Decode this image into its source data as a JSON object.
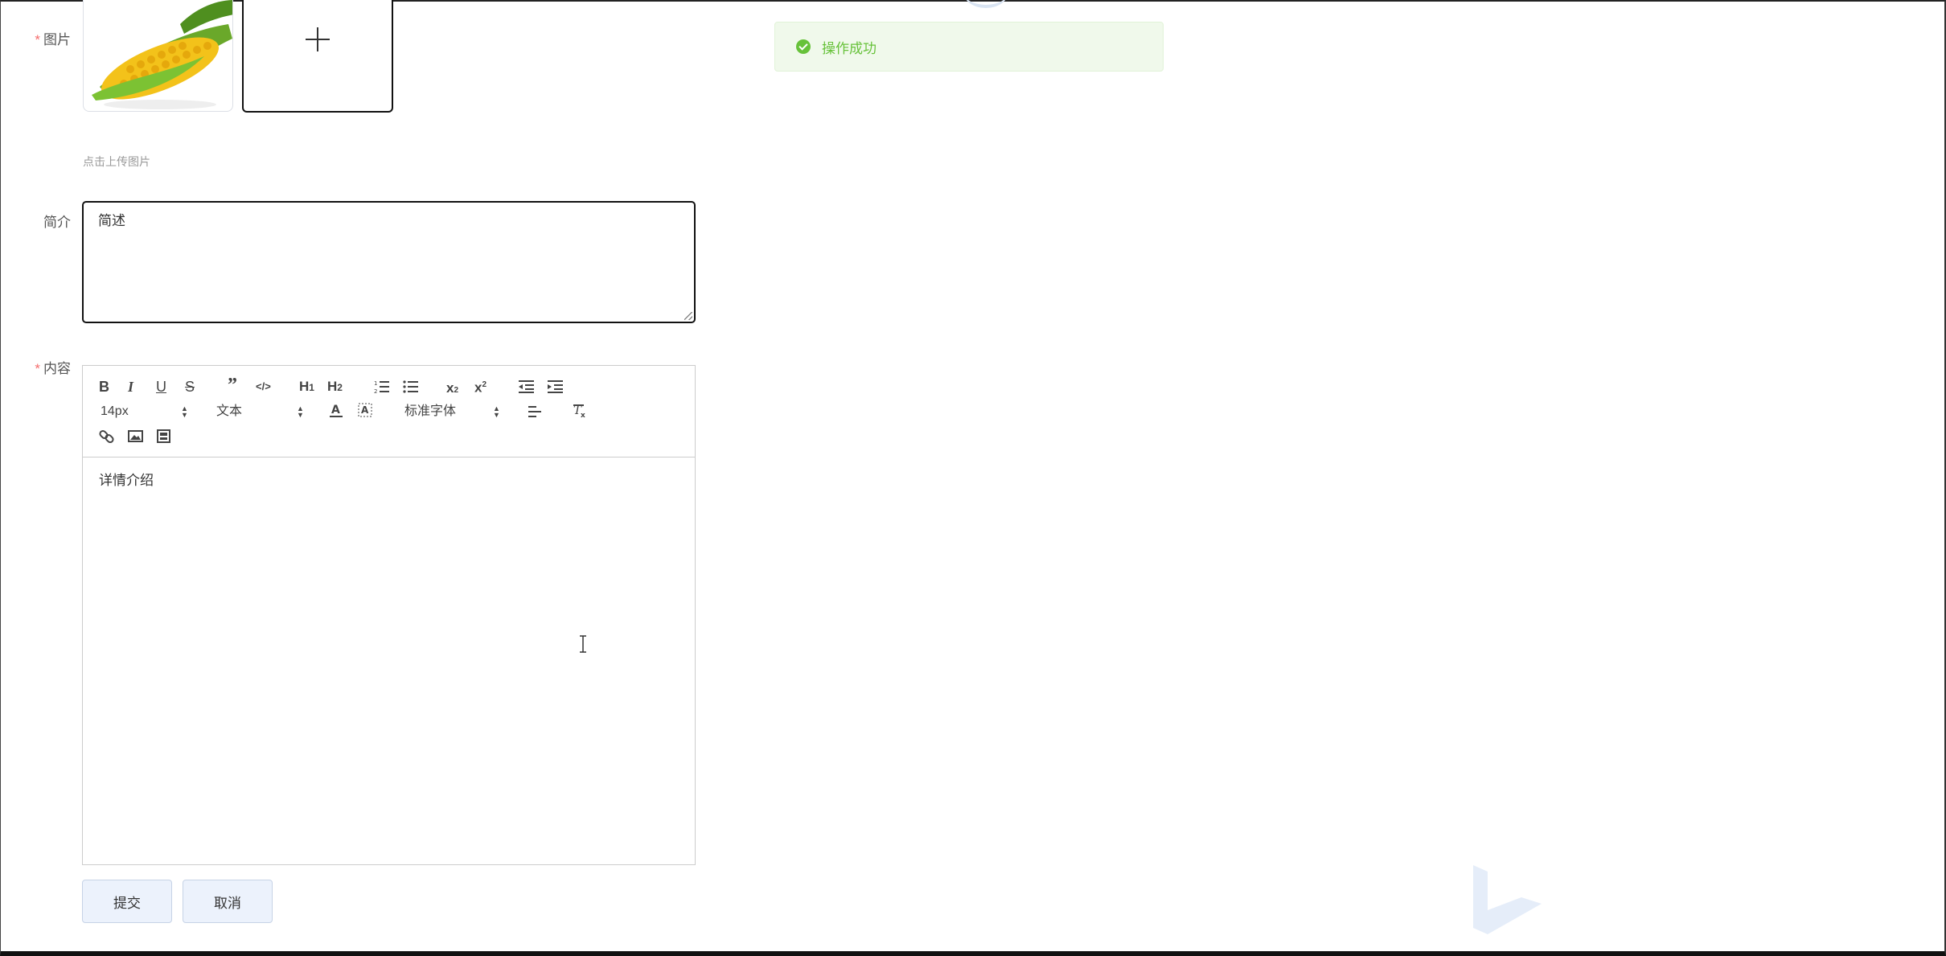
{
  "form": {
    "image_label": "图片",
    "upload_tip": "点击上传图片",
    "intro_label": "简介",
    "intro_value": "简述",
    "content_label": "内容"
  },
  "editor": {
    "font_size": "14px",
    "header_style": "文本",
    "font_family": "标准字体",
    "content": "详情介绍"
  },
  "buttons": {
    "submit": "提交",
    "cancel": "取消"
  },
  "toast": {
    "message": "操作成功",
    "color": "#67c23a"
  },
  "icons": [
    "plus-icon",
    "bold-icon",
    "italic-icon",
    "underline-icon",
    "strike-icon",
    "blockquote-icon",
    "code-icon",
    "h1-icon",
    "h2-icon",
    "ordered-list-icon",
    "bullet-list-icon",
    "subscript-icon",
    "superscript-icon",
    "outdent-icon",
    "indent-icon",
    "text-color-icon",
    "background-color-icon",
    "align-icon",
    "clear-format-icon",
    "link-icon",
    "image-icon",
    "video-icon",
    "check-icon"
  ]
}
